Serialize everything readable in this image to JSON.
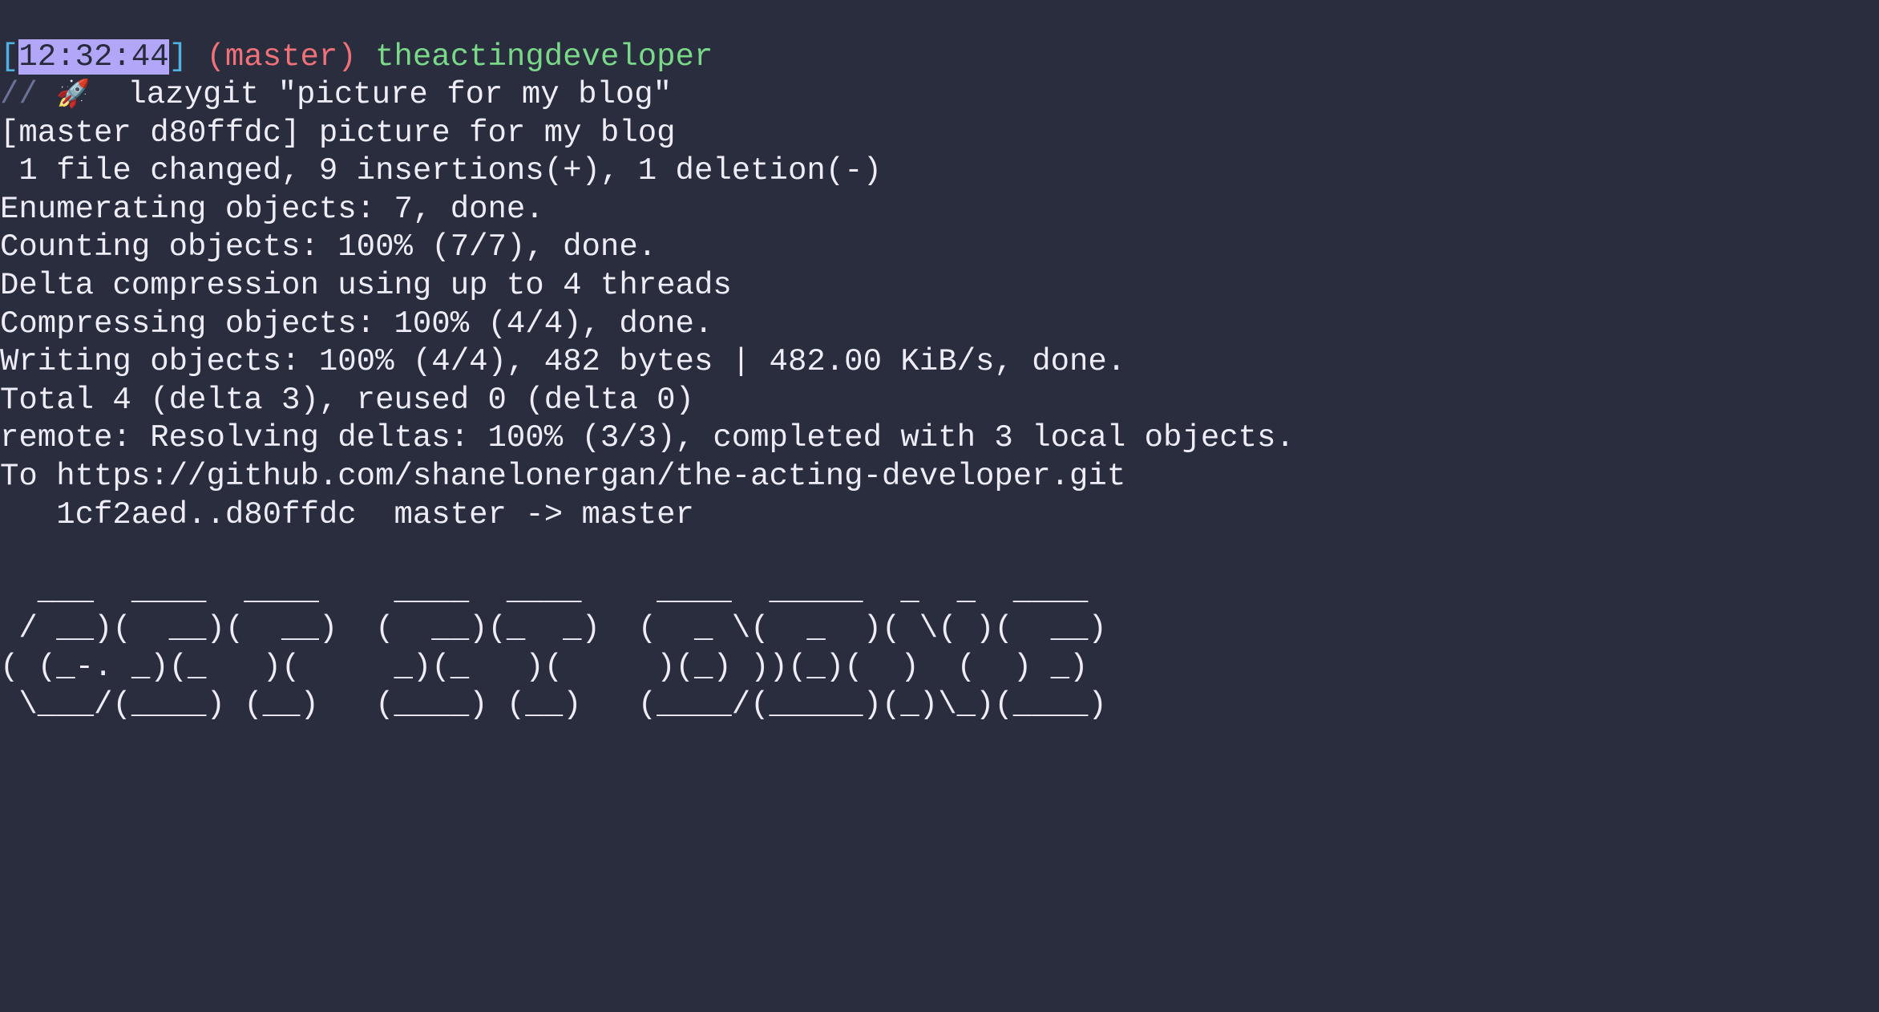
{
  "prompt": {
    "lbracket": "[",
    "time": "12:32:44",
    "rbracket": "]",
    "branch": "(master)",
    "folder": "theactingdeveloper",
    "slashes": "//",
    "rocket": "🚀",
    "command": " lazygit \"picture for my blog\""
  },
  "out": {
    "l1": "[master d80ffdc] picture for my blog",
    "l2": " 1 file changed, 9 insertions(+), 1 deletion(-)",
    "l3": "Enumerating objects: 7, done.",
    "l4": "Counting objects: 100% (7/7), done.",
    "l5": "Delta compression using up to 4 threads",
    "l6": "Compressing objects: 100% (4/4), done.",
    "l7": "Writing objects: 100% (4/4), 482 bytes | 482.00 KiB/s, done.",
    "l8": "Total 4 (delta 3), reused 0 (delta 0)",
    "l9": "remote: Resolving deltas: 100% (3/3), completed with 3 local objects.",
    "l10": "To https://github.com/shanelonergan/the-acting-developer.git",
    "l11": "   1cf2aed..d80ffdc  master -> master",
    "blank": ""
  },
  "ascii": {
    "a1": "  ___  ____  ____    ____  ____    ____  _____  _  _  ____ ",
    "a2": " / __)(  __)(  __)  (  __)(_  _)  (  _ \\(  _  )( \\( )(  __)",
    "a3": "( (_-. _)(_   )(     _)(_   )(     )(_) ))(_)(  )  (  ) _) ",
    "a4": " \\___/(____) (__)   (____) (__)   (____/(_____)(_)\\_)(____)"
  }
}
